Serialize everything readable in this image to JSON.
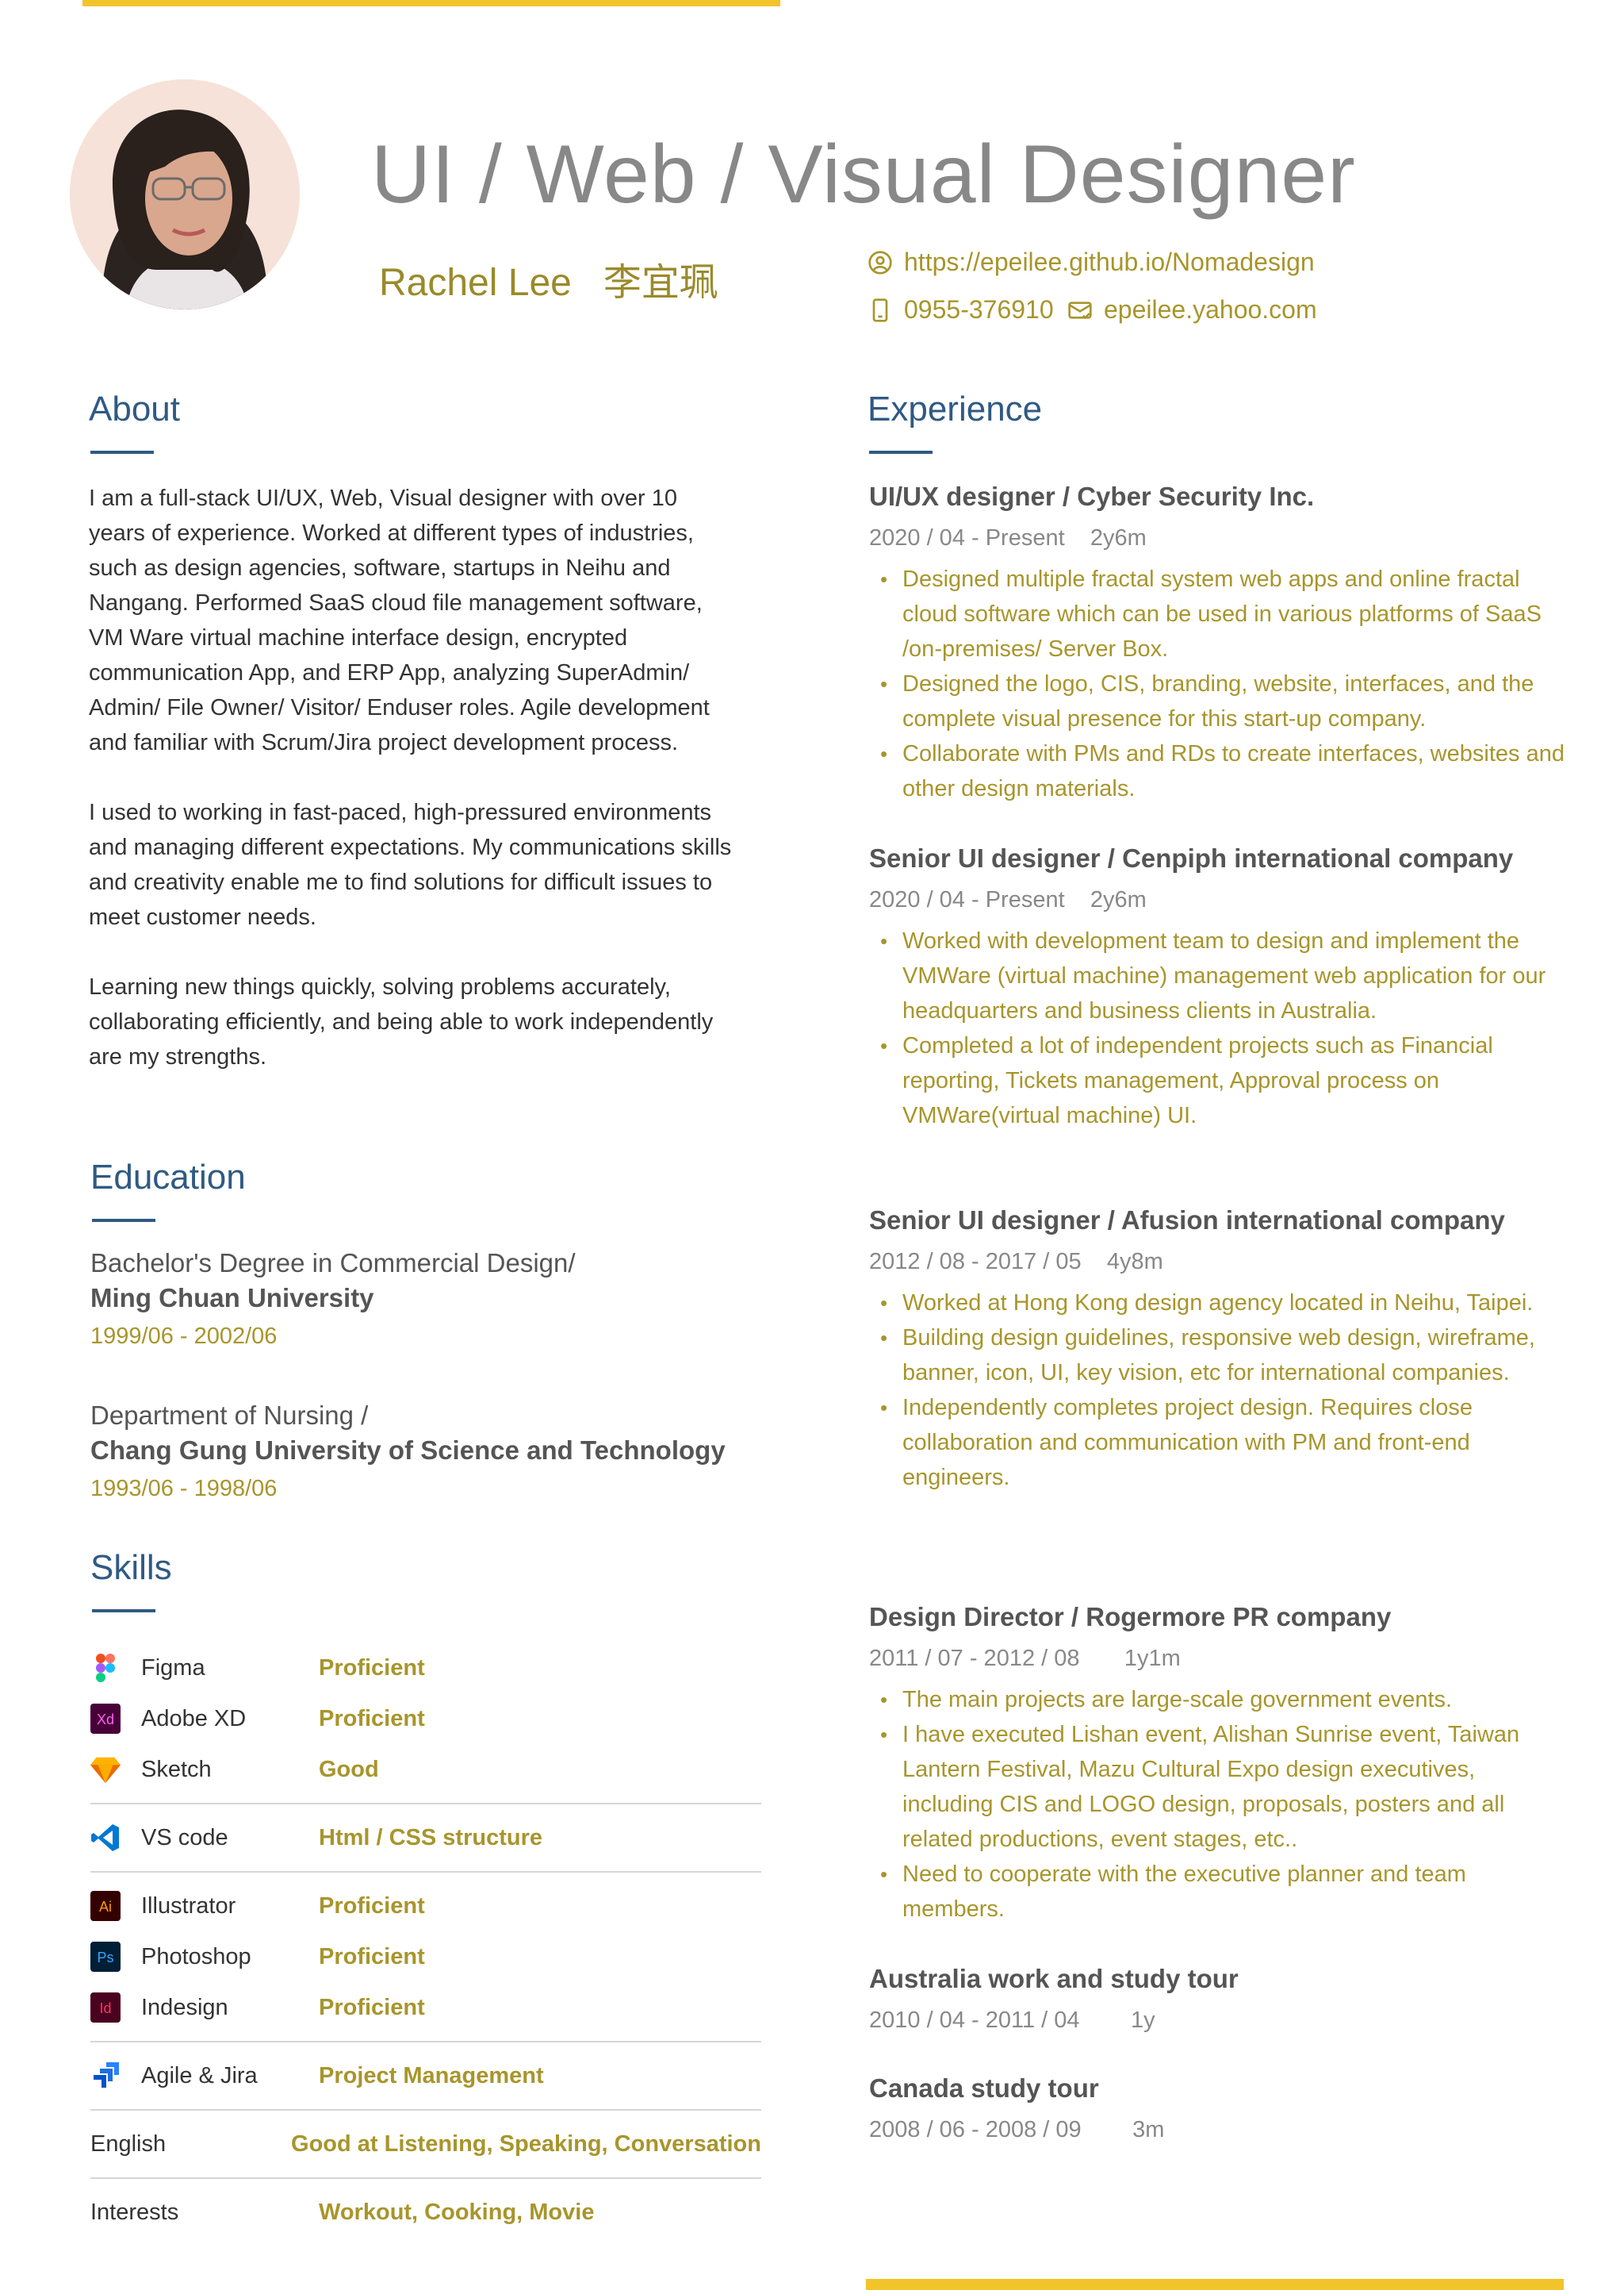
{
  "header": {
    "title": "UI / Web / Visual Designer",
    "name": "Rachel Lee",
    "name_zh": "李宜珮",
    "website": "https://epeilee.github.io/Nomadesign",
    "phone": "0955-376910",
    "email": "epeilee.yahoo.com"
  },
  "about": {
    "title": "About",
    "paragraphs": [
      "I am a full-stack UI/UX, Web, Visual designer with over 10 years of experience. Worked at different types of industries, such as design agencies, software, startups in Neihu and Nangang. Performed SaaS cloud file management software, VM Ware virtual machine interface design, encrypted communication App, and ERP App, analyzing SuperAdmin/ Admin/ File Owner/ Visitor/ Enduser roles. Agile development and familiar with Scrum/Jira project development process.",
      "I used to working in fast-paced, high-pressured environments and managing different expectations. My communications skills and creativity enable me to find solutions for difficult issues to meet customer needs.",
      "Learning new things quickly, solving problems accurately, collaborating efficiently, and being able to work independently are my strengths."
    ]
  },
  "education": {
    "title": "Education",
    "items": [
      {
        "line1": "Bachelor's Degree in Commercial Design/",
        "line2": "Ming Chuan University",
        "dates": "1999/06 - 2002/06"
      },
      {
        "line1": "Department of Nursing /",
        "line2": "Chang Gung University of Science and Technology",
        "dates": "1993/06 - 1998/06"
      }
    ]
  },
  "skills": {
    "title": "Skills",
    "items": [
      {
        "name": "Figma",
        "level": "Proficient",
        "icon": "figma-icon"
      },
      {
        "name": "Adobe XD",
        "level": "Proficient",
        "icon": "adobe-xd-icon"
      },
      {
        "name": "Sketch",
        "level": "Good",
        "icon": "sketch-icon"
      },
      {
        "name": "VS code",
        "level": "Html / CSS structure",
        "icon": "vscode-icon"
      },
      {
        "name": "Illustrator",
        "level": "Proficient",
        "icon": "illustrator-icon"
      },
      {
        "name": "Photoshop",
        "level": "Proficient",
        "icon": "photoshop-icon"
      },
      {
        "name": "Indesign",
        "level": "Proficient",
        "icon": "indesign-icon"
      },
      {
        "name": "Agile & Jira",
        "level": "Project Management",
        "icon": "jira-icon"
      },
      {
        "name": "English",
        "level": "Good at Listening, Speaking, Conversation"
      },
      {
        "name": "Interests",
        "level": "Workout, Cooking, Movie"
      }
    ]
  },
  "experience": {
    "title": "Experience",
    "items": [
      {
        "role": "UI/UX designer / Cyber Security Inc.",
        "dates": "2020 / 04 - Present    2y6m",
        "bullets": [
          "Designed multiple fractal system web apps and online fractal cloud software which can be used in various platforms of SaaS /on-premises/ Server Box.",
          "Designed the logo, CIS, branding, website, interfaces, and the complete visual presence for this start-up company.",
          "Collaborate with PMs and RDs to create interfaces, websites and other design materials."
        ]
      },
      {
        "role": "Senior  UI designer / Cenpiph international company",
        "dates": "2020 / 04 - Present    2y6m",
        "bullets": [
          "Worked with development team to design and implement the VMWare (virtual machine) management web application for our headquarters and business clients in Australia.",
          "Completed a lot of independent projects such as Financial reporting, Tickets management, Approval process  on VMWare(virtual machine) UI."
        ]
      },
      {
        "role": "Senior  UI designer / Afusion international company",
        "dates": "2012 / 08 - 2017 / 05    4y8m",
        "bullets": [
          "Worked at Hong Kong design agency located in Neihu, Taipei.",
          "Building design guidelines, responsive web design, wireframe, banner, icon, UI, key vision, etc for international companies.",
          "Independently completes project design. Requires close collaboration and communication with PM and front-end engineers."
        ]
      },
      {
        "role": "Design Director / Rogermore PR company",
        "dates": "2011 / 07 - 2012 / 08       1y1m",
        "bullets": [
          "The main projects are large-scale government events.",
          "I have executed Lishan event, Alishan Sunrise event, Taiwan Lantern Festival, Mazu Cultural Expo design executives, including CIS and LOGO design, proposals, posters and all related productions, event stages, etc..",
          "Need to cooperate with the executive planner and team members."
        ]
      },
      {
        "role": "Australia work and study tour",
        "dates": "2010 / 04 - 2011 / 04        1y",
        "bullets": []
      },
      {
        "role": "Canada study tour",
        "dates": "2008 / 06 - 2008 / 09        3m",
        "bullets": []
      }
    ]
  },
  "colors": {
    "accent_yellow": "#f2c42c",
    "heading_blue": "#2f5a84",
    "gold_text": "#a8952c",
    "headline_gray": "#888888"
  }
}
